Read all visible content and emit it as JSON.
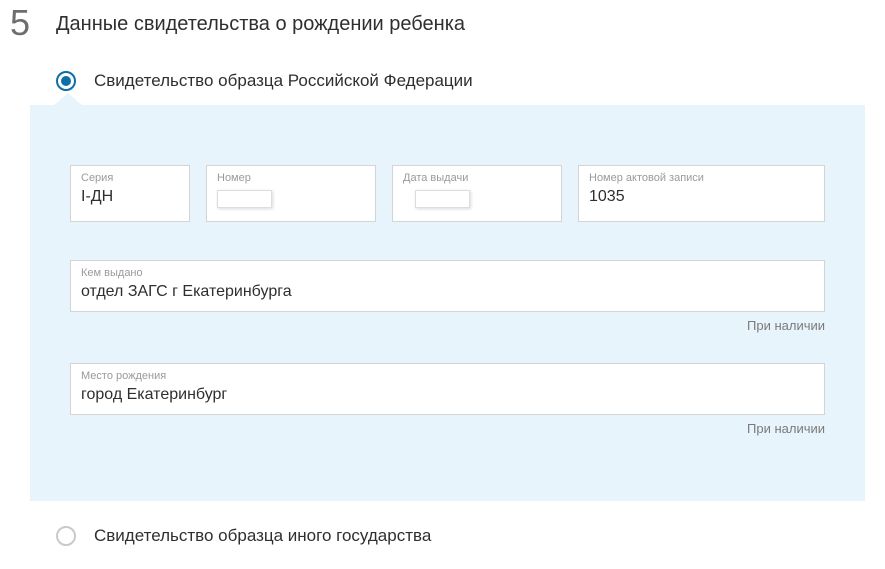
{
  "step": {
    "number": "5",
    "title": "Данные свидетельства о рождении ребенка"
  },
  "radio": {
    "option1": "Свидетельство образца Российской Федерации",
    "option2": "Свидетельство образца иного государства"
  },
  "fields": {
    "series": {
      "label": "Серия",
      "value": "I-ДН"
    },
    "number": {
      "label": "Номер",
      "value": ""
    },
    "issue_date": {
      "label": "Дата выдачи",
      "value": ""
    },
    "record_number": {
      "label": "Номер актовой записи",
      "value": "1035"
    },
    "issued_by": {
      "label": "Кем выдано",
      "value": "отдел ЗАГС г Екатеринбурга"
    },
    "birth_place": {
      "label": "Место рождения",
      "value": "город Екатеринбург"
    }
  },
  "hints": {
    "optional": "При наличии"
  }
}
